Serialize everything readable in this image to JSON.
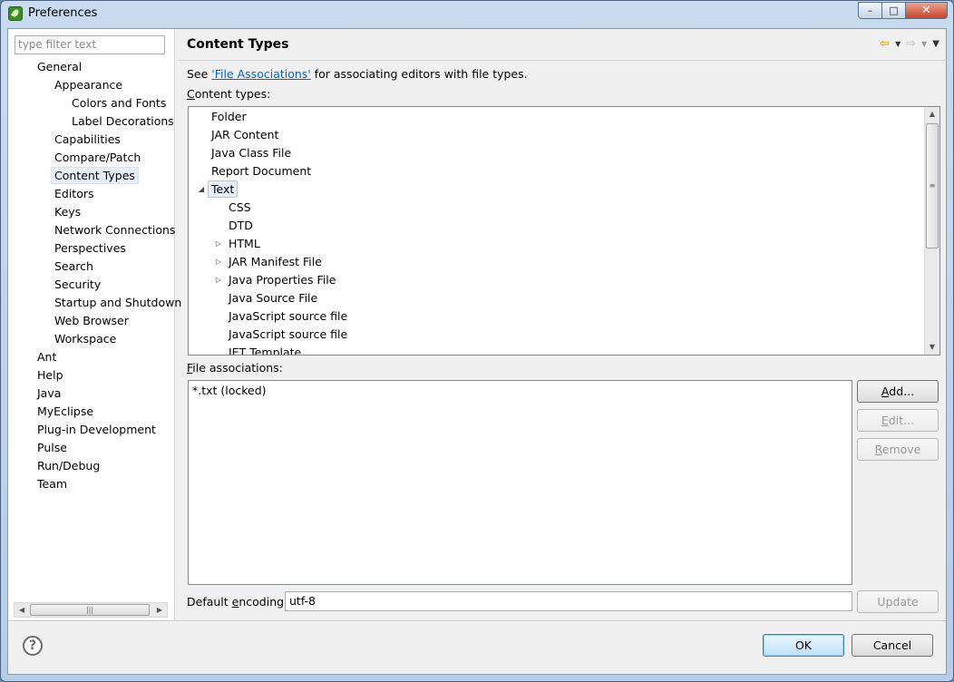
{
  "window": {
    "title": "Preferences",
    "min_glyph": "–",
    "max_glyph": "□",
    "close_glyph": "✕"
  },
  "left": {
    "filter_placeholder": "type filter text",
    "tree": [
      {
        "label": "General",
        "level": 0
      },
      {
        "label": "Appearance",
        "level": 1
      },
      {
        "label": "Colors and Fonts",
        "level": 2
      },
      {
        "label": "Label Decorations",
        "level": 2
      },
      {
        "label": "Capabilities",
        "level": 1
      },
      {
        "label": "Compare/Patch",
        "level": 1
      },
      {
        "label": "Content Types",
        "level": 1,
        "selected": true
      },
      {
        "label": "Editors",
        "level": 1
      },
      {
        "label": "Keys",
        "level": 1
      },
      {
        "label": "Network Connections",
        "level": 1
      },
      {
        "label": "Perspectives",
        "level": 1
      },
      {
        "label": "Search",
        "level": 1
      },
      {
        "label": "Security",
        "level": 1
      },
      {
        "label": "Startup and Shutdown",
        "level": 1
      },
      {
        "label": "Web Browser",
        "level": 1
      },
      {
        "label": "Workspace",
        "level": 1
      },
      {
        "label": "Ant",
        "level": 0
      },
      {
        "label": "Help",
        "level": 0
      },
      {
        "label": "Java",
        "level": 0
      },
      {
        "label": "MyEclipse",
        "level": 0
      },
      {
        "label": "Plug-in Development",
        "level": 0
      },
      {
        "label": "Pulse",
        "level": 0
      },
      {
        "label": "Run/Debug",
        "level": 0
      },
      {
        "label": "Team",
        "level": 0
      }
    ]
  },
  "right": {
    "title": "Content Types",
    "see_prefix": "See ",
    "see_link": "'File Associations'",
    "see_suffix": " for associating editors with file types.",
    "content_types_label_mnemonic": "C",
    "content_types_label_rest": "ontent types:",
    "content_types": [
      {
        "label": "Folder",
        "level": 0,
        "twisty": ""
      },
      {
        "label": "JAR Content",
        "level": 0,
        "twisty": ""
      },
      {
        "label": "Java Class File",
        "level": 0,
        "twisty": ""
      },
      {
        "label": "Report Document",
        "level": 0,
        "twisty": ""
      },
      {
        "label": "Text",
        "level": 0,
        "twisty": "expanded",
        "selected": true
      },
      {
        "label": "CSS",
        "level": 1,
        "twisty": ""
      },
      {
        "label": "DTD",
        "level": 1,
        "twisty": ""
      },
      {
        "label": "HTML",
        "level": 1,
        "twisty": "collapsed"
      },
      {
        "label": "JAR Manifest File",
        "level": 1,
        "twisty": "collapsed"
      },
      {
        "label": "Java Properties File",
        "level": 1,
        "twisty": "collapsed"
      },
      {
        "label": "Java Source File",
        "level": 1,
        "twisty": ""
      },
      {
        "label": "JavaScript source file",
        "level": 1,
        "twisty": ""
      },
      {
        "label": "JavaScript source file",
        "level": 1,
        "twisty": ""
      },
      {
        "label": "JET Template",
        "level": 1,
        "twisty": ""
      }
    ],
    "file_assoc_label_mnemonic": "F",
    "file_assoc_label_rest": "ile associations:",
    "file_associations": [
      "*.txt (locked)"
    ],
    "buttons": {
      "add_mnemonic": "A",
      "add_rest": "dd...",
      "edit_mnemonic": "E",
      "edit_rest": "dit...",
      "remove_mnemonic": "R",
      "remove_rest": "emove",
      "update": "Update",
      "ok": "OK",
      "cancel": "Cancel"
    },
    "encoding_label_prefix": "Default ",
    "encoding_label_mnemonic": "e",
    "encoding_label_rest": "ncoding:",
    "encoding_value": "utf-8"
  },
  "icons": {
    "back": "⇦",
    "forward": "⇨",
    "dropdown": "▼",
    "menu": "▼",
    "expanded": "◢",
    "collapsed": "▷",
    "scroll_up": "▲",
    "scroll_down": "▼",
    "scroll_left": "◀",
    "scroll_right": "▶",
    "grip_v": "≡",
    "grip_h": "|||",
    "help": "?"
  },
  "colors": {
    "link": "#0066cc",
    "title_bar": "#c9dbef",
    "close_button": "#c9442c"
  }
}
